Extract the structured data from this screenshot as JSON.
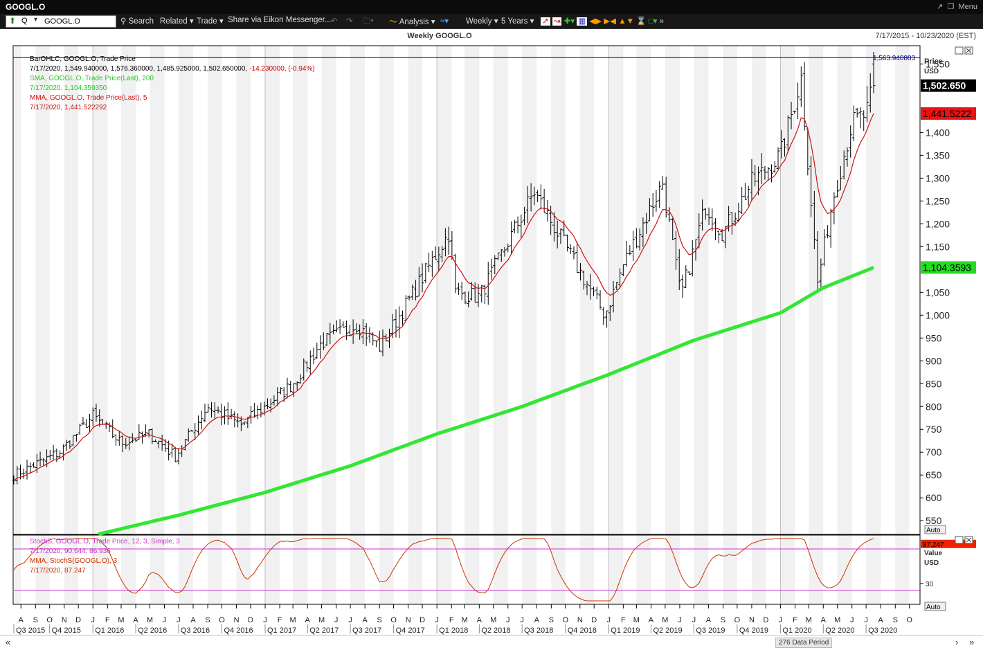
{
  "window": {
    "title": "GOOGL.O",
    "menu_label": "Menu"
  },
  "toolbar": {
    "ric": "GOOGL.O",
    "q_label": "Q",
    "search": "Search",
    "related": "Related",
    "trade": "Trade",
    "share": "Share via Eikon Messenger...",
    "analysis": "Analysis",
    "interval": "Weekly",
    "range": "5 Years"
  },
  "header": {
    "chart_title": "Weekly GOOGL.O",
    "date_range": "7/17/2015 - 10/23/2020 (EST)"
  },
  "legend": {
    "ohlc_name": "BarOHLC, GOOGL.O, Trade Price",
    "ohlc_values": "7/17/2020, 1,549.940000, 1,576.360000, 1,485.925000, 1,502.650000,",
    "ohlc_change": "-14.230000, (-0.94%)",
    "sma_name": "SMA, GOOGL.O, Trade Price(Last), 200",
    "sma_value": "7/17/2020, 1,104.359350",
    "mma_name": "MMA, GOOGL.O, Trade Price(Last), 5",
    "mma_value": "7/17/2020, 1,441.522292",
    "stoch_name": "StochS, GOOGL.O, Trade Price, 12, 3, Simple, 3",
    "stoch_value": "7/17/2020, 90.644, 86.936",
    "smma_name": "MMA, StochS(GOOGL.O), 3",
    "smma_value": "7/17/2020, 87.247"
  },
  "axis": {
    "price_label": "Price",
    "currency": "USD",
    "auto": "Auto",
    "value_label": "Value",
    "value_unit": "USD",
    "crosshair_label": "1,563.940803",
    "last_price_tag": "1,502.650",
    "mma_tag": "1,441.5222",
    "sma_tag": "1,104.3593",
    "stoch_tag": "87.247"
  },
  "status": {
    "data_count": "276 Data Period"
  },
  "colors": {
    "bars": "#000000",
    "sma": "#33e633",
    "mma": "#cc1111",
    "stoch": "#cc3300",
    "stoch_bands": "#cc33cc",
    "crosshair": "#000080"
  },
  "chart_data": [
    {
      "type": "ohlc-bar",
      "title": "Weekly GOOGL.O",
      "interval": "weekly",
      "x_range": [
        "7/17/2015",
        "10/23/2020"
      ],
      "ylabel": "Price USD",
      "ylim": [
        520,
        1590
      ],
      "y_ticks": [
        "550",
        "600",
        "650",
        "700",
        "750",
        "800",
        "850",
        "900",
        "950",
        "1,000",
        "1,050",
        "1,100",
        "1,150",
        "1,200",
        "1,250",
        "1,300",
        "1,350",
        "1,400",
        "1,450",
        "1,500",
        "1,550"
      ],
      "y_tick_values": [
        550,
        600,
        650,
        700,
        750,
        800,
        850,
        900,
        950,
        1000,
        1050,
        1100,
        1150,
        1200,
        1250,
        1300,
        1350,
        1400,
        1450,
        1500,
        1550
      ],
      "crosshair_price": 1563.94,
      "close_anchors": [
        [
          "2015-07-17",
          650
        ],
        [
          "2015-10-23",
          700
        ],
        [
          "2016-01-01",
          780
        ],
        [
          "2016-03-01",
          720
        ],
        [
          "2016-05-01",
          740
        ],
        [
          "2016-06-24",
          690
        ],
        [
          "2016-09-01",
          800
        ],
        [
          "2016-11-10",
          760
        ],
        [
          "2017-01-01",
          800
        ],
        [
          "2017-03-01",
          850
        ],
        [
          "2017-05-01",
          940
        ],
        [
          "2017-07-15",
          980
        ],
        [
          "2017-09-01",
          930
        ],
        [
          "2017-11-01",
          1030
        ],
        [
          "2018-01-26",
          1180
        ],
        [
          "2018-02-09",
          1050
        ],
        [
          "2018-04-01",
          1040
        ],
        [
          "2018-07-27",
          1270
        ],
        [
          "2018-10-01",
          1150
        ],
        [
          "2018-12-24",
          1000
        ],
        [
          "2019-02-01",
          1110
        ],
        [
          "2019-04-26",
          1290
        ],
        [
          "2019-06-03",
          1040
        ],
        [
          "2019-07-26",
          1240
        ],
        [
          "2019-09-01",
          1180
        ],
        [
          "2019-11-01",
          1290
        ],
        [
          "2020-01-01",
          1350
        ],
        [
          "2020-02-14",
          1520
        ],
        [
          "2020-03-20",
          1070
        ],
        [
          "2020-04-20",
          1250
        ],
        [
          "2020-06-01",
          1420
        ],
        [
          "2020-07-01",
          1440
        ],
        [
          "2020-07-17",
          1502.65
        ]
      ],
      "last_bar": {
        "date": "7/17/2020",
        "open": 1549.94,
        "high": 1576.36,
        "low": 1485.925,
        "close": 1502.65
      },
      "series": [
        {
          "name": "SMA, GOOGL.O, Trade Price(Last), 200",
          "last": 1104.35935,
          "points": [
            [
              "2015-12-01",
              510
            ],
            [
              "2016-07-01",
              562
            ],
            [
              "2017-01-01",
              612
            ],
            [
              "2017-07-01",
              670
            ],
            [
              "2018-01-01",
              740
            ],
            [
              "2018-07-01",
              800
            ],
            [
              "2019-01-01",
              870
            ],
            [
              "2019-07-01",
              945
            ],
            [
              "2020-01-01",
              1005
            ],
            [
              "2020-04-01",
              1060
            ],
            [
              "2020-07-17",
              1104.36
            ]
          ]
        },
        {
          "name": "MMA, GOOGL.O, Trade Price(Last), 5",
          "last": 1441.522292
        }
      ]
    },
    {
      "type": "line",
      "title": "StochS, GOOGL.O, Trade Price, 12, 3, Simple, 3",
      "ylabel": "Value USD",
      "ylim": [
        0,
        100
      ],
      "y_ticks": [
        "30"
      ],
      "y_tick_values": [
        30
      ],
      "bands": [
        20,
        80
      ],
      "series": [
        {
          "name": "StochS, GOOGL.O, Trade Price, 12, 3, Simple, 3",
          "last": [
            90.644,
            86.936
          ]
        },
        {
          "name": "MMA, StochS(GOOGL.O), 3",
          "last": 87.247
        }
      ]
    }
  ],
  "x_axis": {
    "months": [
      {
        "label": "A",
        "date": "2015-08-01"
      },
      {
        "label": "S",
        "date": "2015-09-01"
      },
      {
        "label": "O",
        "date": "2015-10-01"
      },
      {
        "label": "N",
        "date": "2015-11-01"
      },
      {
        "label": "D",
        "date": "2015-12-01"
      },
      {
        "label": "J",
        "date": "2016-01-01"
      },
      {
        "label": "F",
        "date": "2016-02-01"
      },
      {
        "label": "M",
        "date": "2016-03-01"
      },
      {
        "label": "A",
        "date": "2016-04-01"
      },
      {
        "label": "M",
        "date": "2016-05-01"
      },
      {
        "label": "J",
        "date": "2016-06-01"
      },
      {
        "label": "J",
        "date": "2016-07-01"
      },
      {
        "label": "A",
        "date": "2016-08-01"
      },
      {
        "label": "S",
        "date": "2016-09-01"
      },
      {
        "label": "O",
        "date": "2016-10-01"
      },
      {
        "label": "N",
        "date": "2016-11-01"
      },
      {
        "label": "D",
        "date": "2016-12-01"
      },
      {
        "label": "J",
        "date": "2017-01-01"
      },
      {
        "label": "F",
        "date": "2017-02-01"
      },
      {
        "label": "M",
        "date": "2017-03-01"
      },
      {
        "label": "A",
        "date": "2017-04-01"
      },
      {
        "label": "M",
        "date": "2017-05-01"
      },
      {
        "label": "J",
        "date": "2017-06-01"
      },
      {
        "label": "J",
        "date": "2017-07-01"
      },
      {
        "label": "A",
        "date": "2017-08-01"
      },
      {
        "label": "S",
        "date": "2017-09-01"
      },
      {
        "label": "O",
        "date": "2017-10-01"
      },
      {
        "label": "N",
        "date": "2017-11-01"
      },
      {
        "label": "D",
        "date": "2017-12-01"
      },
      {
        "label": "J",
        "date": "2018-01-01"
      },
      {
        "label": "F",
        "date": "2018-02-01"
      },
      {
        "label": "M",
        "date": "2018-03-01"
      },
      {
        "label": "A",
        "date": "2018-04-01"
      },
      {
        "label": "M",
        "date": "2018-05-01"
      },
      {
        "label": "J",
        "date": "2018-06-01"
      },
      {
        "label": "J",
        "date": "2018-07-01"
      },
      {
        "label": "A",
        "date": "2018-08-01"
      },
      {
        "label": "S",
        "date": "2018-09-01"
      },
      {
        "label": "O",
        "date": "2018-10-01"
      },
      {
        "label": "N",
        "date": "2018-11-01"
      },
      {
        "label": "D",
        "date": "2018-12-01"
      },
      {
        "label": "J",
        "date": "2019-01-01"
      },
      {
        "label": "F",
        "date": "2019-02-01"
      },
      {
        "label": "M",
        "date": "2019-03-01"
      },
      {
        "label": "A",
        "date": "2019-04-01"
      },
      {
        "label": "M",
        "date": "2019-05-01"
      },
      {
        "label": "J",
        "date": "2019-06-01"
      },
      {
        "label": "J",
        "date": "2019-07-01"
      },
      {
        "label": "A",
        "date": "2019-08-01"
      },
      {
        "label": "S",
        "date": "2019-09-01"
      },
      {
        "label": "O",
        "date": "2019-10-01"
      },
      {
        "label": "N",
        "date": "2019-11-01"
      },
      {
        "label": "D",
        "date": "2019-12-01"
      },
      {
        "label": "J",
        "date": "2020-01-01"
      },
      {
        "label": "F",
        "date": "2020-02-01"
      },
      {
        "label": "M",
        "date": "2020-03-01"
      },
      {
        "label": "A",
        "date": "2020-04-01"
      },
      {
        "label": "M",
        "date": "2020-05-01"
      },
      {
        "label": "J",
        "date": "2020-06-01"
      },
      {
        "label": "J",
        "date": "2020-07-01"
      },
      {
        "label": "A",
        "date": "2020-08-01"
      },
      {
        "label": "S",
        "date": "2020-09-01"
      },
      {
        "label": "O",
        "date": "2020-10-01"
      }
    ],
    "quarters": [
      {
        "label": "Q3 2015",
        "date": "2015-07-17"
      },
      {
        "label": "Q4 2015",
        "date": "2015-10-01"
      },
      {
        "label": "Q1 2016",
        "date": "2016-01-01"
      },
      {
        "label": "Q2 2016",
        "date": "2016-04-01"
      },
      {
        "label": "Q3 2016",
        "date": "2016-07-01"
      },
      {
        "label": "Q4 2016",
        "date": "2016-10-01"
      },
      {
        "label": "Q1 2017",
        "date": "2017-01-01"
      },
      {
        "label": "Q2 2017",
        "date": "2017-04-01"
      },
      {
        "label": "Q3 2017",
        "date": "2017-07-01"
      },
      {
        "label": "Q4 2017",
        "date": "2017-10-01"
      },
      {
        "label": "Q1 2018",
        "date": "2018-01-01"
      },
      {
        "label": "Q2 2018",
        "date": "2018-04-01"
      },
      {
        "label": "Q3 2018",
        "date": "2018-07-01"
      },
      {
        "label": "Q4 2018",
        "date": "2018-10-01"
      },
      {
        "label": "Q1 2019",
        "date": "2019-01-01"
      },
      {
        "label": "Q2 2019",
        "date": "2019-04-01"
      },
      {
        "label": "Q3 2019",
        "date": "2019-07-01"
      },
      {
        "label": "Q4 2019",
        "date": "2019-10-01"
      },
      {
        "label": "Q1 2020",
        "date": "2020-01-01"
      },
      {
        "label": "Q2 2020",
        "date": "2020-04-01"
      },
      {
        "label": "Q3 2020",
        "date": "2020-07-01"
      }
    ]
  }
}
